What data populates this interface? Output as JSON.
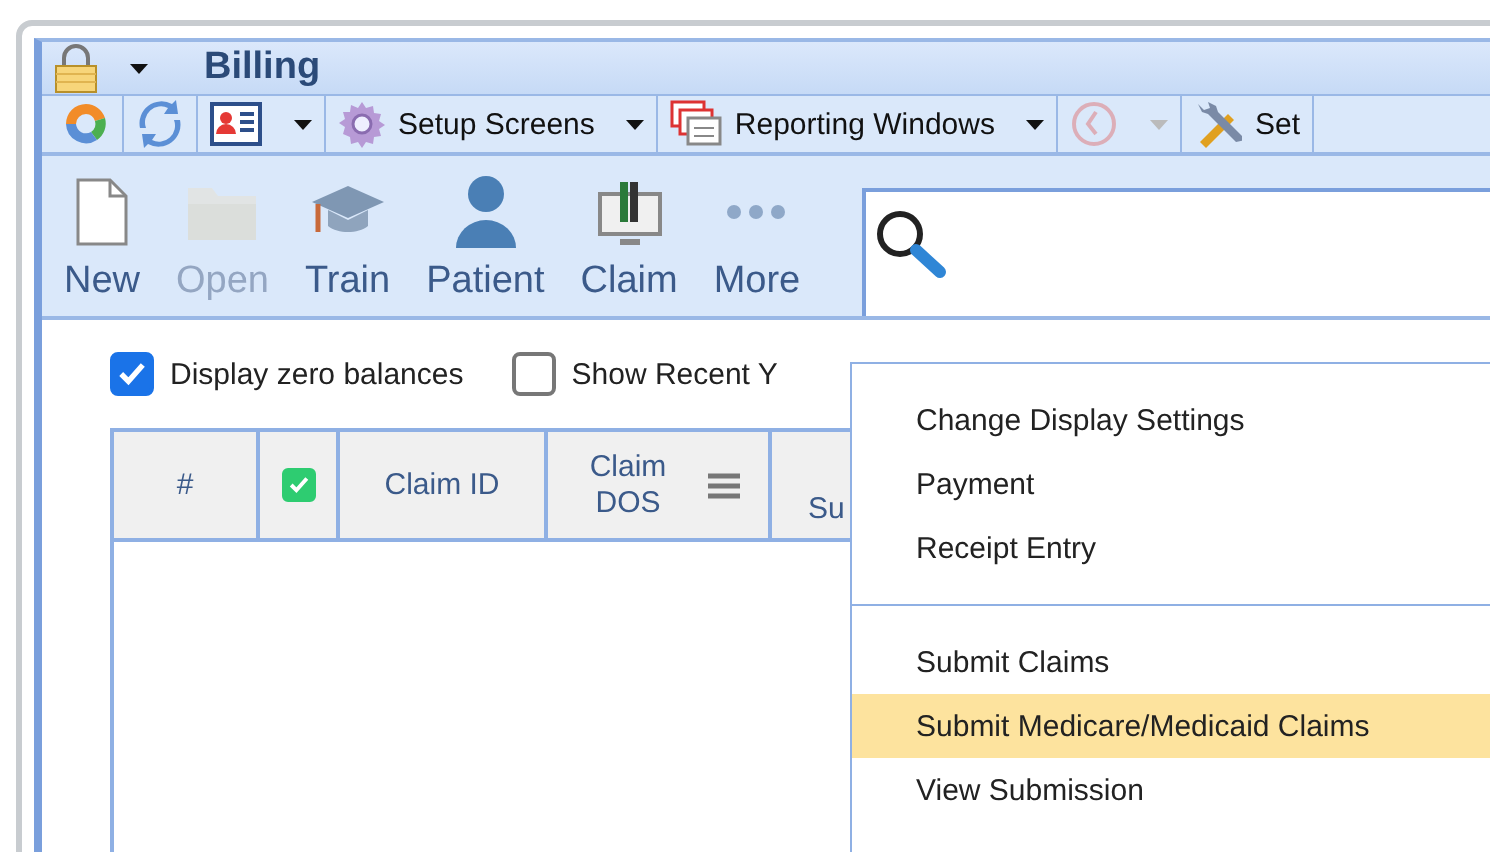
{
  "window": {
    "title": "Billing"
  },
  "toolbar": [
    {
      "kind": "circle",
      "dropdown": false,
      "disabled": false
    },
    {
      "kind": "refresh",
      "dropdown": false,
      "disabled": false
    },
    {
      "kind": "card",
      "dropdown": true,
      "disabled": false
    },
    {
      "kind": "gear",
      "label": "Setup Screens",
      "dropdown": true,
      "disabled": false
    },
    {
      "kind": "windows",
      "label": "Reporting Windows",
      "dropdown": true,
      "disabled": false
    },
    {
      "kind": "history",
      "dropdown": true,
      "disabled": true
    },
    {
      "kind": "tools",
      "label": "Set",
      "dropdown": false,
      "disabled": false
    }
  ],
  "ribbon": [
    {
      "kind": "new",
      "label": "New",
      "disabled": false
    },
    {
      "kind": "open",
      "label": "Open",
      "disabled": true
    },
    {
      "kind": "train",
      "label": "Train",
      "disabled": false
    },
    {
      "kind": "patient",
      "label": "Patient",
      "disabled": false
    },
    {
      "kind": "claim",
      "label": "Claim",
      "disabled": false
    },
    {
      "kind": "more",
      "label": "More",
      "disabled": false
    }
  ],
  "options": [
    {
      "label": "Display zero balances",
      "checked": true
    },
    {
      "label": "Show Recent Y",
      "checked": false
    }
  ],
  "table": {
    "columns": [
      {
        "kind": "text",
        "label": "#"
      },
      {
        "kind": "check",
        "checked": true
      },
      {
        "kind": "text",
        "label": "Claim ID"
      },
      {
        "kind": "menu",
        "label": "Claim DOS"
      },
      {
        "kind": "text",
        "label": "Su"
      }
    ]
  },
  "menu": {
    "groups": [
      [
        {
          "label": "Change Display Settings",
          "selected": false
        },
        {
          "label": "Payment",
          "selected": false
        },
        {
          "label": "Receipt Entry",
          "selected": false
        }
      ],
      [
        {
          "label": "Submit Claims",
          "selected": false
        },
        {
          "label": "Submit Medicare/Medicaid Claims",
          "selected": true
        },
        {
          "label": "View Submission",
          "selected": false
        }
      ]
    ]
  }
}
